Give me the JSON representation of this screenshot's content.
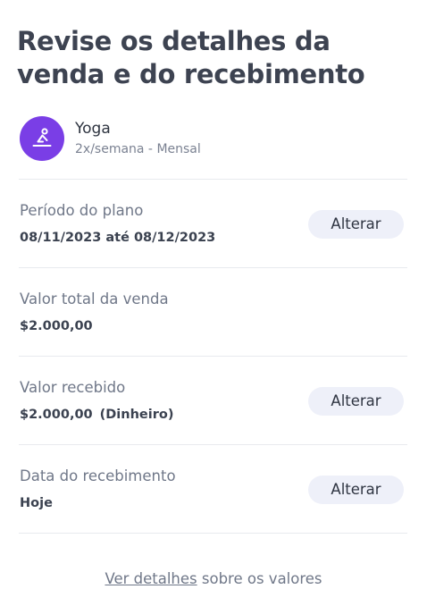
{
  "page": {
    "title": "Revise os detalhes da venda e do recebimento"
  },
  "product": {
    "name": "Yoga",
    "subtitle": "2x/semana - Mensal",
    "icon": "yoga-icon",
    "avatar_color": "#7a3ee6"
  },
  "rows": [
    {
      "label": "Período do plano",
      "value": "08/11/2023 até 08/12/2023",
      "action": "Alterar"
    },
    {
      "label": "Valor total da venda",
      "value": "$2.000,00"
    },
    {
      "label": "Valor recebido",
      "value": "$2.000,00",
      "value_suffix": "(Dinheiro)",
      "action": "Alterar"
    },
    {
      "label": "Data do recebimento",
      "value": "Hoje",
      "action": "Alterar"
    }
  ],
  "footer": {
    "link_text": "Ver detalhes",
    "rest_text": " sobre os valores"
  }
}
